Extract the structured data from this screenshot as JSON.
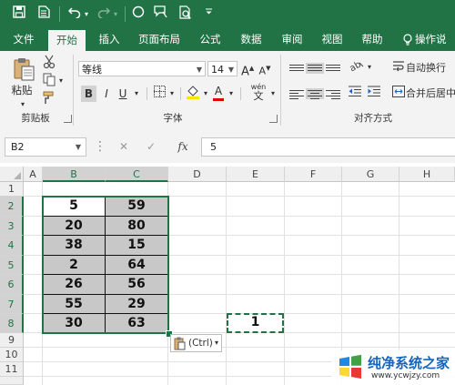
{
  "qat": {
    "save_icon": "save-icon",
    "undo_icon": "undo-icon",
    "redo_icon": "redo-icon",
    "customize_icon": "chevron-down-icon"
  },
  "tabs": [
    {
      "label": "文件"
    },
    {
      "label": "开始"
    },
    {
      "label": "插入"
    },
    {
      "label": "页面布局"
    },
    {
      "label": "公式"
    },
    {
      "label": "数据"
    },
    {
      "label": "审阅"
    },
    {
      "label": "视图"
    },
    {
      "label": "帮助"
    },
    {
      "label": "操作说"
    }
  ],
  "ribbon": {
    "clipboard": {
      "paste_label": "粘贴",
      "group_label": "剪贴板"
    },
    "font": {
      "font_name": "等线",
      "font_size": "14",
      "grow": "A",
      "shrink": "A",
      "bold": "B",
      "italic": "I",
      "underline": "U",
      "font_color_glyph": "A",
      "phonetic": "wén",
      "group_label": "字体"
    },
    "alignment": {
      "wrap_text": "自动换行",
      "merge_center": "合并后居中",
      "group_label": "对齐方式"
    }
  },
  "formula_bar": {
    "name_box": "B2",
    "fx": "fx",
    "value": "5"
  },
  "columns": [
    "A",
    "B",
    "C",
    "D",
    "E",
    "F",
    "G",
    "H"
  ],
  "rows": [
    "1",
    "2",
    "3",
    "4",
    "5",
    "6",
    "7",
    "8",
    "9",
    "10",
    "11"
  ],
  "table": {
    "col_b": [
      "5",
      "20",
      "38",
      "2",
      "26",
      "55",
      "30"
    ],
    "col_c": [
      "59",
      "80",
      "15",
      "64",
      "56",
      "29",
      "63"
    ]
  },
  "copied_cell_value": "1",
  "paste_options_label": "(Ctrl)",
  "watermark": {
    "title": "纯净系统之家",
    "url": "www.ycwjzy.com"
  },
  "colors": {
    "accent": "#217346",
    "selected_fill": "#c8c8c8"
  }
}
